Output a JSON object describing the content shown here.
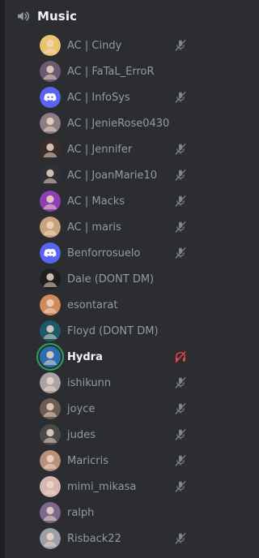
{
  "channel": {
    "name": "Music",
    "icon": "speaker-icon"
  },
  "colors": {
    "background": "#2b2d31",
    "muted_text": "#949ba4",
    "active_text": "#f2f3f5",
    "icon_grey": "#80848e",
    "deafen_red": "#f23f43",
    "speaking_ring": "#23a55a",
    "discord_blurple": "#5865f2"
  },
  "members": [
    {
      "name": "AC | Cindy",
      "avatar": "photo",
      "avatar_color": "#e9c46a",
      "status_icon": "mic-muted-icon",
      "active": false
    },
    {
      "name": "AC | FaTaL_ErroR",
      "avatar": "photo",
      "avatar_color": "#6b5a73",
      "status_icon": "",
      "active": false
    },
    {
      "name": "AC | InfoSys",
      "avatar": "discord",
      "avatar_color": "#5865f2",
      "status_icon": "mic-muted-icon",
      "active": false
    },
    {
      "name": "AC | JenieRose0430",
      "avatar": "photo",
      "avatar_color": "#8a7d85",
      "status_icon": "",
      "active": false
    },
    {
      "name": "AC | Jennifer",
      "avatar": "photo",
      "avatar_color": "#3a2e2a",
      "status_icon": "mic-muted-icon",
      "active": false
    },
    {
      "name": "AC | JoanMarie10",
      "avatar": "photo",
      "avatar_color": "#2f3136",
      "status_icon": "mic-muted-icon",
      "active": false
    },
    {
      "name": "AC | Macks",
      "avatar": "photo",
      "avatar_color": "#8e3fb3",
      "status_icon": "mic-muted-icon",
      "active": false
    },
    {
      "name": "AC | maris",
      "avatar": "photo",
      "avatar_color": "#c9a27e",
      "status_icon": "mic-muted-icon",
      "active": false
    },
    {
      "name": "Benforrosuelo",
      "avatar": "discord",
      "avatar_color": "#5865f2",
      "status_icon": "mic-muted-icon",
      "active": false
    },
    {
      "name": "Dale (DONT DM)",
      "avatar": "photo",
      "avatar_color": "#1f1f1f",
      "status_icon": "",
      "active": false
    },
    {
      "name": "esontarat",
      "avatar": "photo",
      "avatar_color": "#d08b5b",
      "status_icon": "",
      "active": false
    },
    {
      "name": "Floyd (DONT DM)",
      "avatar": "photo",
      "avatar_color": "#1b5a6a",
      "status_icon": "",
      "active": false
    },
    {
      "name": "Hydra",
      "avatar": "photo",
      "avatar_color": "#2c6fb0",
      "status_icon": "deafened-icon",
      "active": true
    },
    {
      "name": "ishikunn",
      "avatar": "photo",
      "avatar_color": "#a8a4a6",
      "status_icon": "mic-muted-icon",
      "active": false
    },
    {
      "name": "joyce",
      "avatar": "photo",
      "avatar_color": "#6d5d55",
      "status_icon": "mic-muted-icon",
      "active": false
    },
    {
      "name": "judes",
      "avatar": "photo",
      "avatar_color": "#4a4a4a",
      "status_icon": "mic-muted-icon",
      "active": false
    },
    {
      "name": "Maricris",
      "avatar": "photo",
      "avatar_color": "#b98f7e",
      "status_icon": "mic-muted-icon",
      "active": false
    },
    {
      "name": "mimi_mikasa",
      "avatar": "photo",
      "avatar_color": "#d7b7b2",
      "status_icon": "mic-muted-icon",
      "active": false
    },
    {
      "name": "ralph",
      "avatar": "photo",
      "avatar_color": "#7b6a8e",
      "status_icon": "",
      "active": false
    },
    {
      "name": "Risback22",
      "avatar": "photo",
      "avatar_color": "#9aa0a6",
      "status_icon": "mic-muted-icon",
      "active": false
    }
  ]
}
